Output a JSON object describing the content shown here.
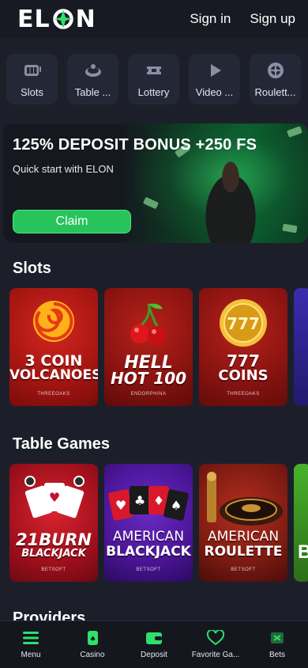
{
  "header": {
    "logo_left": "EL",
    "logo_right": "N",
    "sign_in": "Sign in",
    "sign_up": "Sign up"
  },
  "categories": [
    {
      "label": "Slots",
      "icon": "slot-machine-icon"
    },
    {
      "label": "Table ...",
      "icon": "roulette-wheel-icon"
    },
    {
      "label": "Lottery",
      "icon": "ticket-icon"
    },
    {
      "label": "Video ...",
      "icon": "play-icon"
    },
    {
      "label": "Roulett...",
      "icon": "roulette-icon"
    }
  ],
  "banner": {
    "title": "125% DEPOSIT BONUS +250 FS",
    "subtitle": "Quick start with ELON",
    "button": "Claim"
  },
  "slots": {
    "title": "Slots",
    "games": [
      {
        "line1": "3 COIN",
        "line2": "VOLCANOES",
        "provider": "THREEOAKS"
      },
      {
        "line1": "HELL",
        "line2": "HOT 100",
        "provider": "ENDORPHINA"
      },
      {
        "line1": "777",
        "line2": "COINS",
        "provider": "THREEOAKS"
      }
    ]
  },
  "table_games": {
    "title": "Table Games",
    "games": [
      {
        "line1": "21BURN",
        "line2": "BLACKJACK",
        "provider": "BETSOFT"
      },
      {
        "line1": "AMERICAN",
        "line2": "BLACKJACK",
        "provider": "BETSOFT"
      },
      {
        "line1": "AMERICAN",
        "line2": "ROULETTE",
        "provider": "BETSOFT"
      }
    ],
    "edge_letter": "B"
  },
  "providers": {
    "title": "Providers"
  },
  "bottom_nav": [
    {
      "label": "Menu",
      "icon": "menu-icon"
    },
    {
      "label": "Casino",
      "icon": "casino-icon"
    },
    {
      "label": "Deposit",
      "icon": "wallet-icon"
    },
    {
      "label": "Favorite Ga...",
      "icon": "heart-icon"
    },
    {
      "label": "Bets",
      "icon": "bets-icon"
    }
  ],
  "colors": {
    "accent": "#26c45a",
    "background": "#1c1f29",
    "card": "#242836"
  }
}
